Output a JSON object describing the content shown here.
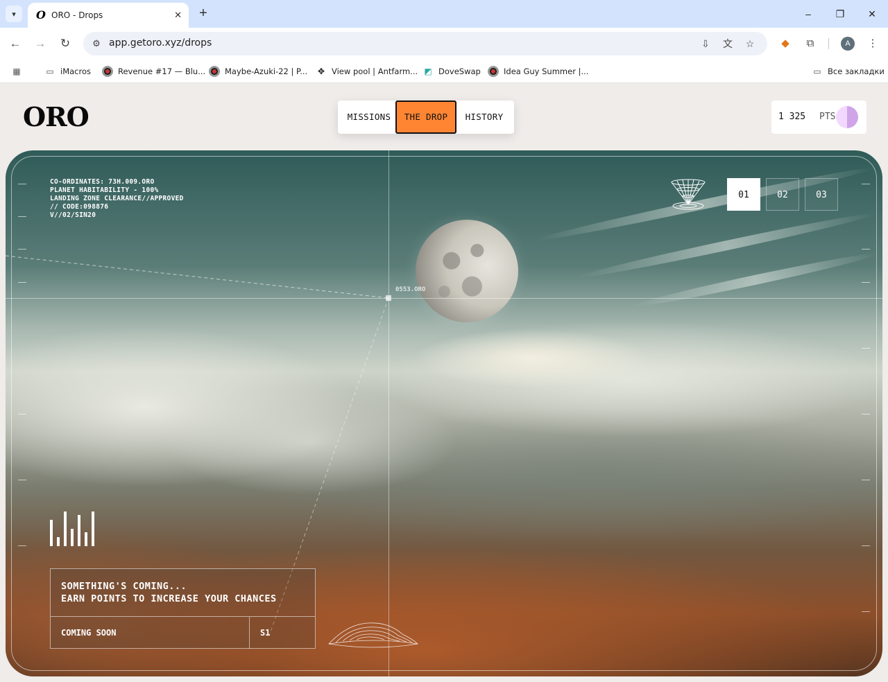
{
  "browser": {
    "tab_title": "ORO - Drops",
    "url": "app.getoro.xyz/drops",
    "bookmarks": [
      {
        "label": "iMacros",
        "icon": "folder-icon"
      },
      {
        "label": "Revenue #17 — Blu...",
        "icon": "eye-favicon"
      },
      {
        "label": "Maybe-Azuki-22 | P...",
        "icon": "eye-favicon"
      },
      {
        "label": "View pool | Antfarm...",
        "icon": "antfarm-favicon"
      },
      {
        "label": "DoveSwap",
        "icon": "doveswap-favicon"
      },
      {
        "label": "Idea Guy Summer |...",
        "icon": "eye-favicon"
      }
    ],
    "all_bookmarks": "Все закладки",
    "profile_initial": "A"
  },
  "app": {
    "logo": "ORO",
    "nav": {
      "missions": "MISSIONS",
      "the_drop": "THE DROP",
      "history": "HISTORY",
      "active": "the_drop"
    },
    "points": {
      "value": "1 325",
      "unit": "PTS"
    }
  },
  "hero": {
    "hud_lines": [
      "CO-ORDINATES: 73H.009.ORO",
      "PLANET HABITABILITY - 100%",
      "LANDING ZONE CLEARANCE//APPROVED",
      "// CODE:098876",
      "V//02/SIN20"
    ],
    "coord_label": "0553.ORO",
    "slides": [
      "01",
      "02",
      "03"
    ],
    "active_slide": "01",
    "signal_bars": [
      0.75,
      0.25,
      1.0,
      0.5,
      0.9,
      0.4,
      1.0
    ],
    "card": {
      "line1": "SOMETHING'S COMING...",
      "line2": "EARN POINTS TO INCREASE YOUR CHANCES",
      "status": "COMING SOON",
      "season": "S1"
    }
  },
  "colors": {
    "accent": "#ff8533",
    "tabbar": "#d3e3fd"
  }
}
